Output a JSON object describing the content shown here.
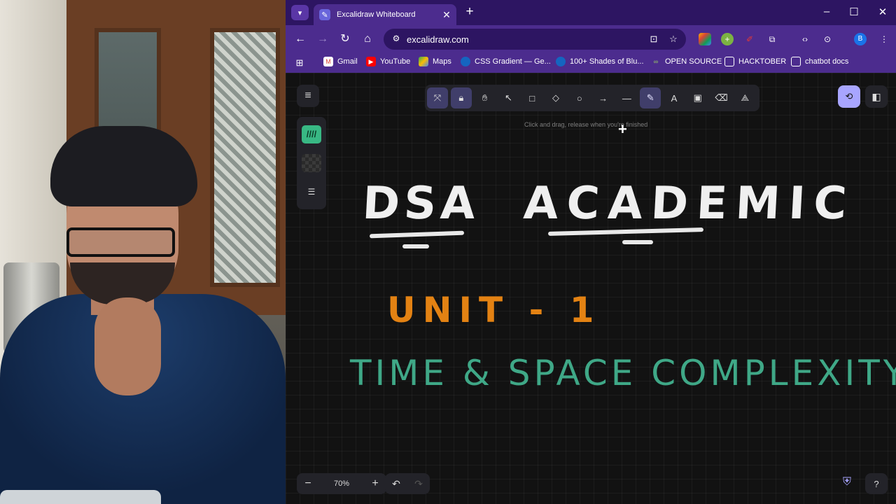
{
  "browser": {
    "tab_title": "Excalidraw Whiteboard",
    "url": "excalidraw.com",
    "profile_initial": "B",
    "accent": "#4c2c8e",
    "titlebar_color": "#2d1562",
    "bookmarks": [
      {
        "label": "Gmail",
        "icon": "gmail-icon"
      },
      {
        "label": "YouTube",
        "icon": "youtube-icon"
      },
      {
        "label": "Maps",
        "icon": "maps-icon"
      },
      {
        "label": "CSS Gradient — Ge...",
        "icon": "globe-icon"
      },
      {
        "label": "100+ Shades of Blu...",
        "icon": "globe-icon"
      },
      {
        "label": "OPEN SOURCE",
        "icon": "link-icon"
      },
      {
        "label": "HACKTOBER",
        "icon": "folder-icon"
      },
      {
        "label": "chatbot docs",
        "icon": "folder-icon"
      }
    ]
  },
  "excalidraw": {
    "hint": "Click and drag, release when you're finished",
    "zoom": "70%",
    "active_tool": "freedraw",
    "stroke_color": "#38b884",
    "tools": [
      "keep-tool-active",
      "lock",
      "hand",
      "selection",
      "rectangle",
      "diamond",
      "ellipse",
      "arrow",
      "line",
      "draw",
      "text",
      "image",
      "eraser",
      "extra-tools"
    ]
  },
  "canvas_text": {
    "title_left": "DSA",
    "title_right": "ACADEMIC",
    "unit": "UNIT - 1",
    "topic": "TIME & SPACE COMPLEXITY",
    "colors": {
      "title": "#efefef",
      "unit": "#e38213",
      "topic": "#3fa887"
    }
  }
}
